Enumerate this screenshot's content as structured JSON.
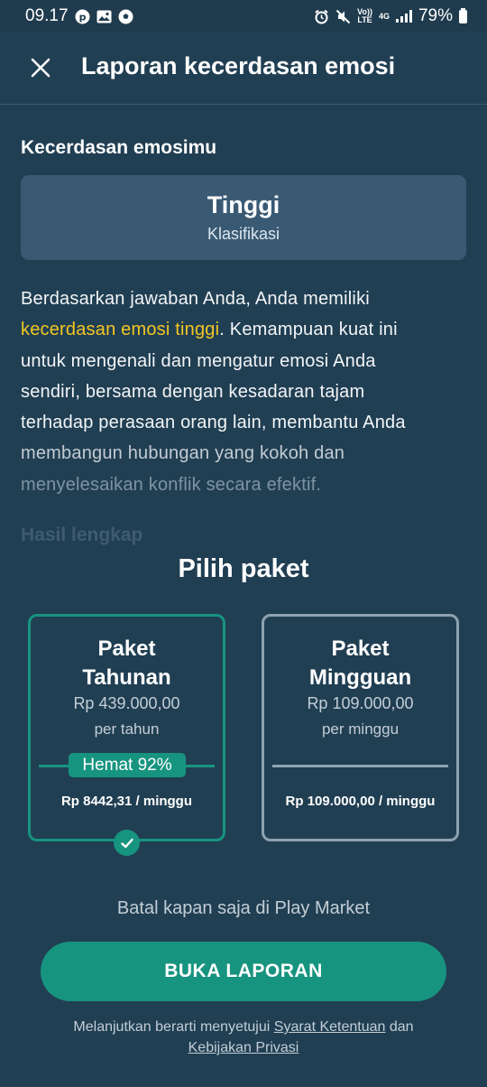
{
  "status_bar": {
    "time": "09.17",
    "battery": "79%",
    "net_top": "Vo))",
    "net_bottom": "LTE",
    "gen": "4G",
    "icons": [
      "pinterest-icon",
      "image-icon",
      "soccer-icon",
      "alarm-icon",
      "mute-icon",
      "signal-icon",
      "battery-icon"
    ]
  },
  "header": {
    "title": "Laporan kecerdasan emosi",
    "close_icon": "close-icon"
  },
  "result": {
    "section_label": "Kecerdasan emosimu",
    "value": "Tinggi",
    "caption": "Klasifikasi"
  },
  "description": {
    "line1": "Berdasarkan jawaban Anda, Anda memiliki",
    "highlight": "kecerdasan emosi tinggi",
    "line2_rest": ". Kemampuan kuat ini",
    "line3": "untuk mengenali dan mengatur emosi Anda",
    "line4": "sendiri, bersama dengan kesadaran tajam",
    "line5": "terhadap perasaan orang lain, membantu Anda",
    "line6": "membangun hubungan yang kokoh dan",
    "line7": "menyelesaikan konflik secara efektif."
  },
  "full_results_label": "Hasil lengkap",
  "plans": {
    "heading": "Pilih paket",
    "annual": {
      "name_line1": "Paket",
      "name_line2": "Tahunan",
      "price": "Rp 439.000,00",
      "period": "per tahun",
      "savings": "Hemat 92%",
      "per_week": "Rp 8442,31 / minggu",
      "selected": true
    },
    "weekly": {
      "name_line1": "Paket",
      "name_line2": "Mingguan",
      "price": "Rp 109.000,00",
      "period": "per minggu",
      "per_week": "Rp 109.000,00 / minggu",
      "selected": false
    }
  },
  "cancel_note": "Batal kapan saja di Play Market",
  "cta_label": "BUKA LAPORAN",
  "legal": {
    "prefix": "Melanjutkan berarti menyetujui",
    "terms": "Syarat Ketentuan",
    "and": "dan",
    "privacy": "Kebijakan Privasi"
  },
  "colors": {
    "background": "#213f53",
    "accent": "#17947f",
    "highlight": "#f3c623",
    "card": "#3a5a74"
  }
}
